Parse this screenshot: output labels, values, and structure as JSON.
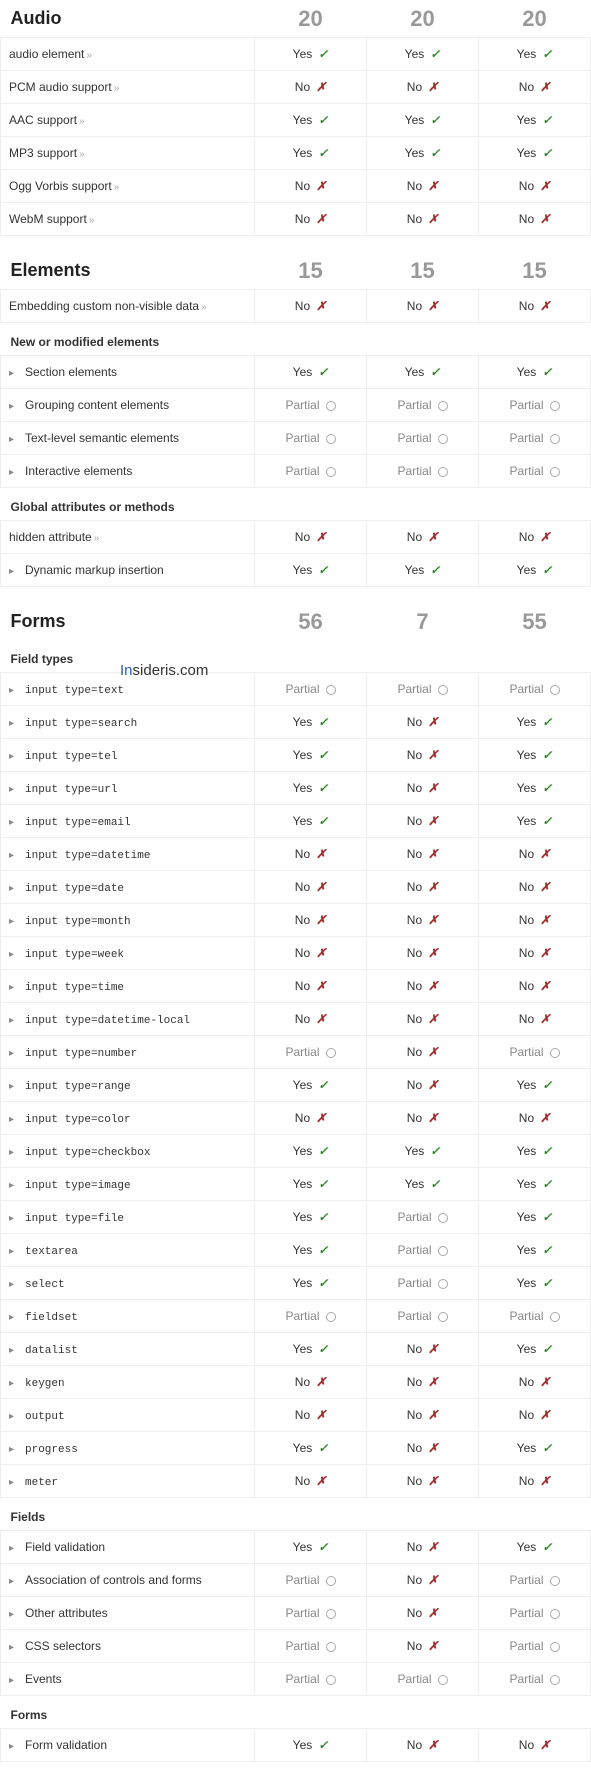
{
  "statusLabels": {
    "yes": "Yes",
    "no": "No",
    "partial": "Partial"
  },
  "watermark": {
    "prefix": "In",
    "rest": "sideris.com"
  },
  "sections": [
    {
      "title": "Audio",
      "scores": [
        "20",
        "20",
        "20"
      ],
      "groups": [
        {
          "rows": [
            {
              "label": "audio element",
              "more": true,
              "cells": [
                "yes",
                "yes",
                "yes"
              ]
            },
            {
              "label": "PCM audio support",
              "more": true,
              "cells": [
                "no",
                "no",
                "no"
              ]
            },
            {
              "label": "AAC support",
              "more": true,
              "cells": [
                "yes",
                "yes",
                "yes"
              ]
            },
            {
              "label": "MP3 support",
              "more": true,
              "cells": [
                "yes",
                "yes",
                "yes"
              ]
            },
            {
              "label": "Ogg Vorbis support",
              "more": true,
              "cells": [
                "no",
                "no",
                "no"
              ]
            },
            {
              "label": "WebM support",
              "more": true,
              "cells": [
                "no",
                "no",
                "no"
              ]
            }
          ]
        }
      ]
    },
    {
      "title": "Elements",
      "scores": [
        "15",
        "15",
        "15"
      ],
      "groups": [
        {
          "rows": [
            {
              "label": "Embedding custom non-visible data",
              "more": true,
              "cells": [
                "no",
                "no",
                "no"
              ]
            }
          ]
        },
        {
          "heading": "New or modified elements",
          "rows": [
            {
              "label": "Section elements",
              "expand": true,
              "cells": [
                "yes",
                "yes",
                "yes"
              ]
            },
            {
              "label": "Grouping content elements",
              "expand": true,
              "cells": [
                "partial",
                "partial",
                "partial"
              ]
            },
            {
              "label": "Text-level semantic elements",
              "expand": true,
              "cells": [
                "partial",
                "partial",
                "partial"
              ]
            },
            {
              "label": "Interactive elements",
              "expand": true,
              "cells": [
                "partial",
                "partial",
                "partial"
              ]
            }
          ]
        },
        {
          "heading": "Global attributes or methods",
          "rows": [
            {
              "label": "hidden attribute",
              "more": true,
              "cells": [
                "no",
                "no",
                "no"
              ]
            },
            {
              "label": "Dynamic markup insertion",
              "expand": true,
              "cells": [
                "yes",
                "yes",
                "yes"
              ]
            }
          ]
        }
      ]
    },
    {
      "title": "Forms",
      "scores": [
        "56",
        "7",
        "55"
      ],
      "groups": [
        {
          "heading": "Field types",
          "rows": [
            {
              "label": "input type=text",
              "expand": true,
              "mono": true,
              "cells": [
                "partial",
                "partial",
                "partial"
              ]
            },
            {
              "label": "input type=search",
              "expand": true,
              "mono": true,
              "cells": [
                "yes",
                "no",
                "yes"
              ]
            },
            {
              "label": "input type=tel",
              "expand": true,
              "mono": true,
              "cells": [
                "yes",
                "no",
                "yes"
              ]
            },
            {
              "label": "input type=url",
              "expand": true,
              "mono": true,
              "cells": [
                "yes",
                "no",
                "yes"
              ]
            },
            {
              "label": "input type=email",
              "expand": true,
              "mono": true,
              "cells": [
                "yes",
                "no",
                "yes"
              ]
            },
            {
              "label": "input type=datetime",
              "expand": true,
              "mono": true,
              "cells": [
                "no",
                "no",
                "no"
              ]
            },
            {
              "label": "input type=date",
              "expand": true,
              "mono": true,
              "cells": [
                "no",
                "no",
                "no"
              ]
            },
            {
              "label": "input type=month",
              "expand": true,
              "mono": true,
              "cells": [
                "no",
                "no",
                "no"
              ]
            },
            {
              "label": "input type=week",
              "expand": true,
              "mono": true,
              "cells": [
                "no",
                "no",
                "no"
              ]
            },
            {
              "label": "input type=time",
              "expand": true,
              "mono": true,
              "cells": [
                "no",
                "no",
                "no"
              ]
            },
            {
              "label": "input type=datetime-local",
              "expand": true,
              "mono": true,
              "cells": [
                "no",
                "no",
                "no"
              ]
            },
            {
              "label": "input type=number",
              "expand": true,
              "mono": true,
              "cells": [
                "partial",
                "no",
                "partial"
              ]
            },
            {
              "label": "input type=range",
              "expand": true,
              "mono": true,
              "cells": [
                "yes",
                "no",
                "yes"
              ]
            },
            {
              "label": "input type=color",
              "expand": true,
              "mono": true,
              "cells": [
                "no",
                "no",
                "no"
              ]
            },
            {
              "label": "input type=checkbox",
              "expand": true,
              "mono": true,
              "cells": [
                "yes",
                "yes",
                "yes"
              ]
            },
            {
              "label": "input type=image",
              "expand": true,
              "mono": true,
              "cells": [
                "yes",
                "yes",
                "yes"
              ]
            },
            {
              "label": "input type=file",
              "expand": true,
              "mono": true,
              "cells": [
                "yes",
                "partial",
                "yes"
              ]
            },
            {
              "label": "textarea",
              "expand": true,
              "mono": true,
              "cells": [
                "yes",
                "partial",
                "yes"
              ]
            },
            {
              "label": "select",
              "expand": true,
              "mono": true,
              "cells": [
                "yes",
                "partial",
                "yes"
              ]
            },
            {
              "label": "fieldset",
              "expand": true,
              "mono": true,
              "cells": [
                "partial",
                "partial",
                "partial"
              ]
            },
            {
              "label": "datalist",
              "expand": true,
              "mono": true,
              "cells": [
                "yes",
                "no",
                "yes"
              ]
            },
            {
              "label": "keygen",
              "expand": true,
              "mono": true,
              "cells": [
                "no",
                "no",
                "no"
              ]
            },
            {
              "label": "output",
              "expand": true,
              "mono": true,
              "cells": [
                "no",
                "no",
                "no"
              ]
            },
            {
              "label": "progress",
              "expand": true,
              "mono": true,
              "cells": [
                "yes",
                "no",
                "yes"
              ]
            },
            {
              "label": "meter",
              "expand": true,
              "mono": true,
              "cells": [
                "no",
                "no",
                "no"
              ]
            }
          ]
        },
        {
          "heading": "Fields",
          "rows": [
            {
              "label": "Field validation",
              "expand": true,
              "cells": [
                "yes",
                "no",
                "yes"
              ]
            },
            {
              "label": "Association of controls and forms",
              "expand": true,
              "cells": [
                "partial",
                "no",
                "partial"
              ]
            },
            {
              "label": "Other attributes",
              "expand": true,
              "cells": [
                "partial",
                "no",
                "partial"
              ]
            },
            {
              "label": "CSS selectors",
              "expand": true,
              "cells": [
                "partial",
                "no",
                "partial"
              ]
            },
            {
              "label": "Events",
              "expand": true,
              "cells": [
                "partial",
                "partial",
                "partial"
              ]
            }
          ]
        },
        {
          "heading": "Forms",
          "rows": [
            {
              "label": "Form validation",
              "expand": true,
              "cells": [
                "yes",
                "no",
                "no"
              ]
            }
          ]
        }
      ]
    }
  ]
}
